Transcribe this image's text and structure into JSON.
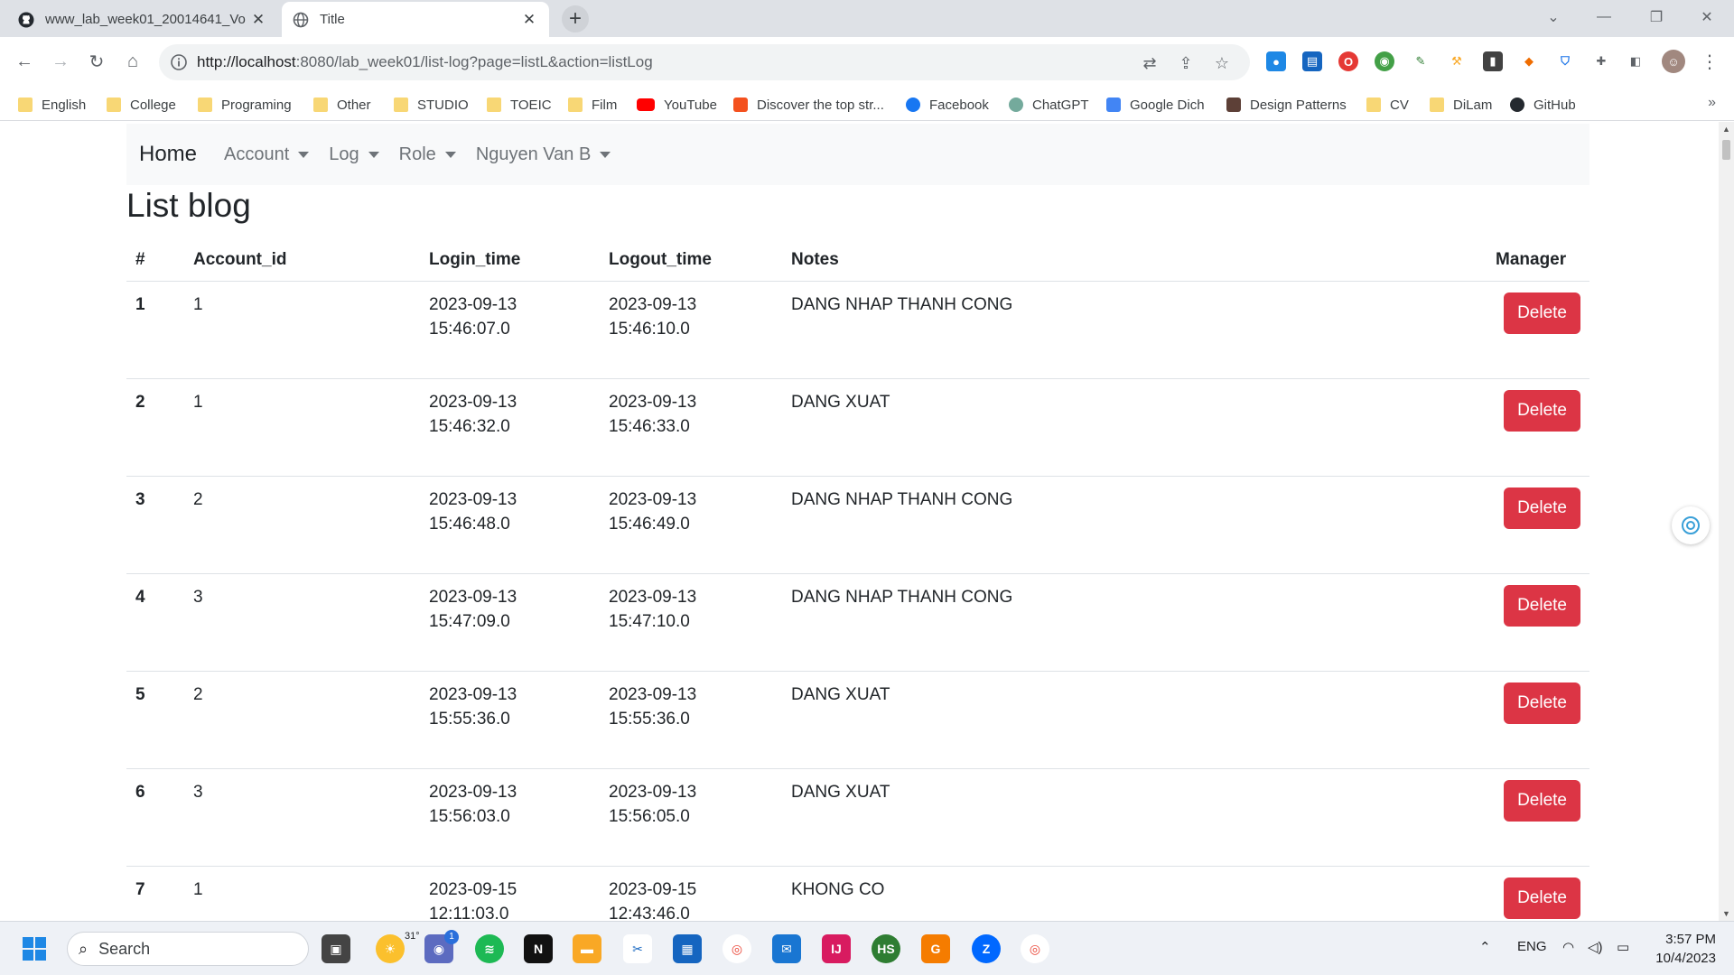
{
  "browser": {
    "tabs": [
      {
        "title": "www_lab_week01_20014641_Vo",
        "active": false
      },
      {
        "title": "Title",
        "active": true
      }
    ],
    "url": {
      "host": "http://localhost",
      "rest": ":8080/lab_week01/list-log?page=listL&action=listLog"
    },
    "bookmarks": [
      "English",
      "College",
      "Programing",
      "Other",
      "STUDIO",
      "TOEIC",
      "Film",
      "YouTube",
      "Discover the top str...",
      "Facebook",
      "ChatGPT",
      "Google Dich",
      "Design Patterns",
      "CV",
      "DiLam",
      "GitHub"
    ],
    "bookmarks_more": "»"
  },
  "navbar": {
    "brand": "Home",
    "menus": [
      "Account",
      "Log",
      "Role",
      "Nguyen Van B"
    ]
  },
  "page": {
    "title": "List blog",
    "columns": [
      "#",
      "Account_id",
      "Login_time",
      "Logout_time",
      "Notes",
      "Manager"
    ],
    "rows": [
      {
        "idx": "1",
        "account_id": "1",
        "login_date": "2023-09-13",
        "login_time": "15:46:07.0",
        "logout_date": "2023-09-13",
        "logout_time": "15:46:10.0",
        "notes": "DANG NHAP THANH CONG",
        "action": "Delete"
      },
      {
        "idx": "2",
        "account_id": "1",
        "login_date": "2023-09-13",
        "login_time": "15:46:32.0",
        "logout_date": "2023-09-13",
        "logout_time": "15:46:33.0",
        "notes": "DANG XUAT",
        "action": "Delete"
      },
      {
        "idx": "3",
        "account_id": "2",
        "login_date": "2023-09-13",
        "login_time": "15:46:48.0",
        "logout_date": "2023-09-13",
        "logout_time": "15:46:49.0",
        "notes": "DANG NHAP THANH CONG",
        "action": "Delete"
      },
      {
        "idx": "4",
        "account_id": "3",
        "login_date": "2023-09-13",
        "login_time": "15:47:09.0",
        "logout_date": "2023-09-13",
        "logout_time": "15:47:10.0",
        "notes": "DANG NHAP THANH CONG",
        "action": "Delete"
      },
      {
        "idx": "5",
        "account_id": "2",
        "login_date": "2023-09-13",
        "login_time": "15:55:36.0",
        "logout_date": "2023-09-13",
        "logout_time": "15:55:36.0",
        "notes": "DANG XUAT",
        "action": "Delete"
      },
      {
        "idx": "6",
        "account_id": "3",
        "login_date": "2023-09-13",
        "login_time": "15:56:03.0",
        "logout_date": "2023-09-13",
        "logout_time": "15:56:05.0",
        "notes": "DANG XUAT",
        "action": "Delete"
      },
      {
        "idx": "7",
        "account_id": "1",
        "login_date": "2023-09-15",
        "login_time": "12:11:03.0",
        "logout_date": "2023-09-15",
        "logout_time": "12:43:46.0",
        "notes": "KHONG CO",
        "action": "Delete"
      }
    ]
  },
  "taskbar": {
    "search_label": "Search",
    "weather_temp": "31°",
    "chat_badge": "1",
    "language": "ENG",
    "time": "3:57 PM",
    "date": "10/4/2023"
  },
  "colors": {
    "danger": "#dc3545",
    "navbar_bg": "#f8f9fa",
    "tabbar_bg": "#dee1e6"
  }
}
